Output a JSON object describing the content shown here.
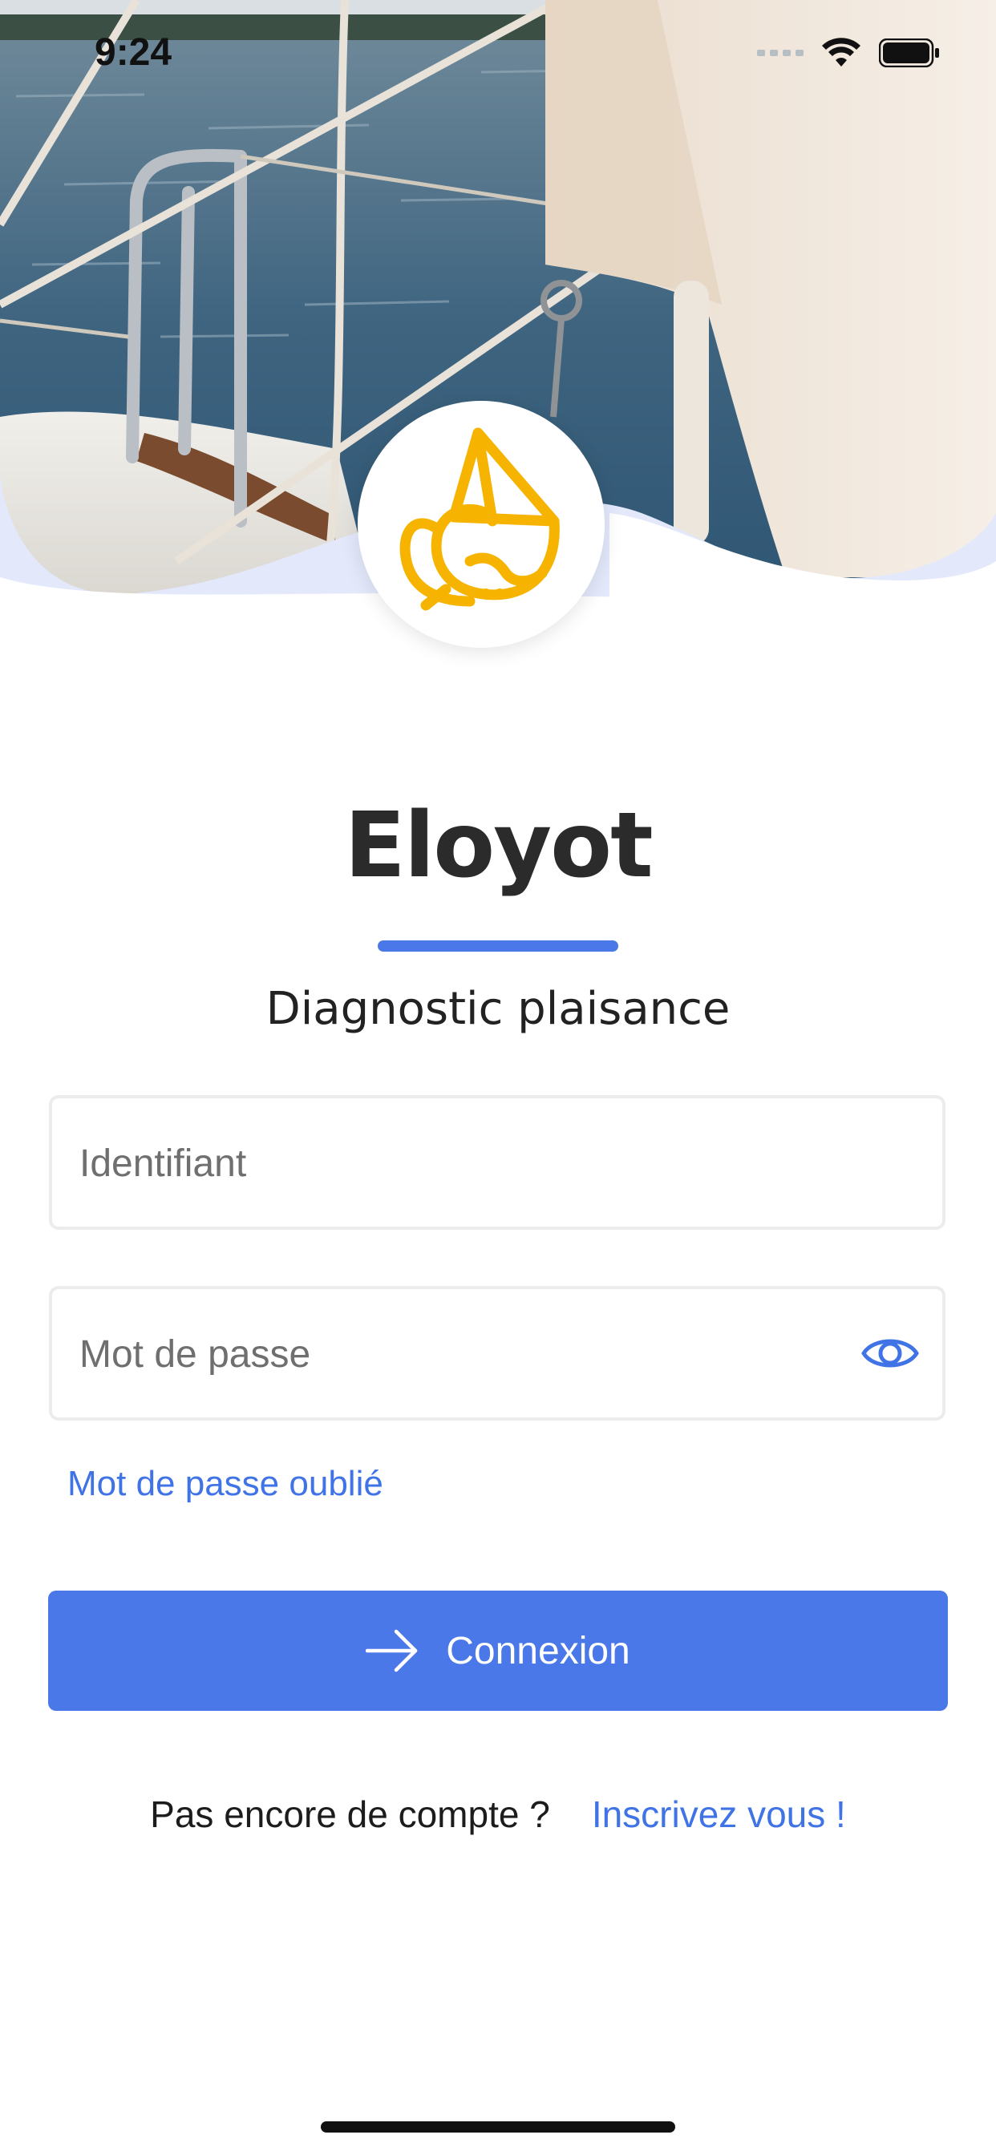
{
  "status_bar": {
    "time": "9:24"
  },
  "app": {
    "title": "Eloyot",
    "subtitle": "Diagnostic plaisance"
  },
  "form": {
    "username_placeholder": "Identifiant",
    "username_value": "",
    "password_placeholder": "Mot de passe",
    "password_value": "",
    "forgot_password": "Mot de passe oublié",
    "submit_label": "Connexion"
  },
  "signup": {
    "prompt": "Pas encore de compte ?",
    "link": "Inscrivez vous !"
  },
  "icons": {
    "logo": "sailboat-logo-icon",
    "password_toggle": "eye-icon",
    "submit": "arrow-right-icon"
  },
  "colors": {
    "accent": "#4a78e8",
    "link": "#3f73e6",
    "logo": "#f6b400",
    "wave": "#e3e8fb"
  }
}
